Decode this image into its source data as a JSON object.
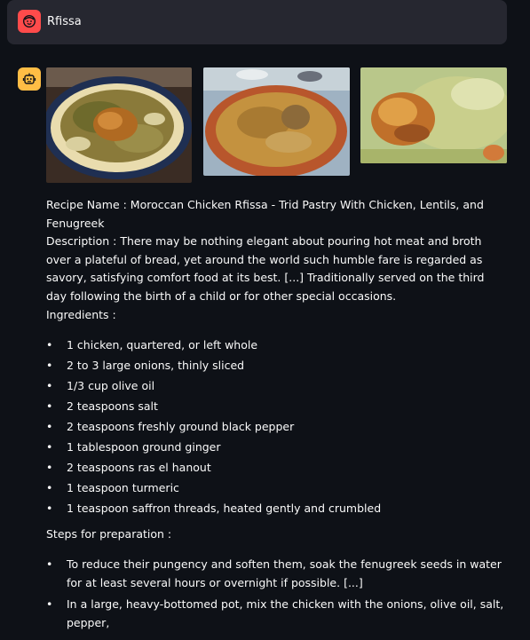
{
  "user_message": {
    "text": "Rfissa",
    "avatar_icon": "smiling-face-icon"
  },
  "assistant": {
    "avatar_icon": "robot-face-icon"
  },
  "images": [
    {
      "name": "rfissa-dish-photo-1"
    },
    {
      "name": "rfissa-dish-photo-2"
    },
    {
      "name": "rfissa-dish-photo-3"
    }
  ],
  "recipe": {
    "name_label": "Recipe Name : ",
    "name_value": "Moroccan Chicken Rfissa - Trid Pastry With Chicken, Lentils, and Fenugreek",
    "description_label": "Description : ",
    "description_value": "There may be nothing elegant about pouring hot meat and broth over a plateful of bread, yet around the world such humble fare is regarded as savory, satisfying comfort food at its best. [...] Traditionally served on the third day following the birth of a child or for other special occasions.",
    "ingredients_label": "Ingredients :",
    "ingredients": [
      "1 chicken, quartered, or left whole",
      "2 to 3 large onions, thinly sliced",
      "1/3 cup olive oil",
      "2 teaspoons salt",
      "2 teaspoons freshly ground black pepper",
      "1 tablespoon ground ginger",
      "2 teaspoons ras el hanout",
      "1 teaspoon turmeric",
      "1 teaspoon saffron threads, heated gently and crumbled"
    ],
    "steps_label": "Steps for preparation :",
    "steps": [
      "To reduce their pungency and soften them, soak the fenugreek seeds in water for at least several hours or overnight if possible. [...]",
      "In a large, heavy-bottomed pot, mix the chicken with the onions, olive oil, salt, pepper,"
    ]
  },
  "colors": {
    "background": "#0e1117",
    "user_bubble": "#262730",
    "user_avatar": "#ff4b4b",
    "bot_avatar": "#ffbd45",
    "text": "#fafafa"
  }
}
